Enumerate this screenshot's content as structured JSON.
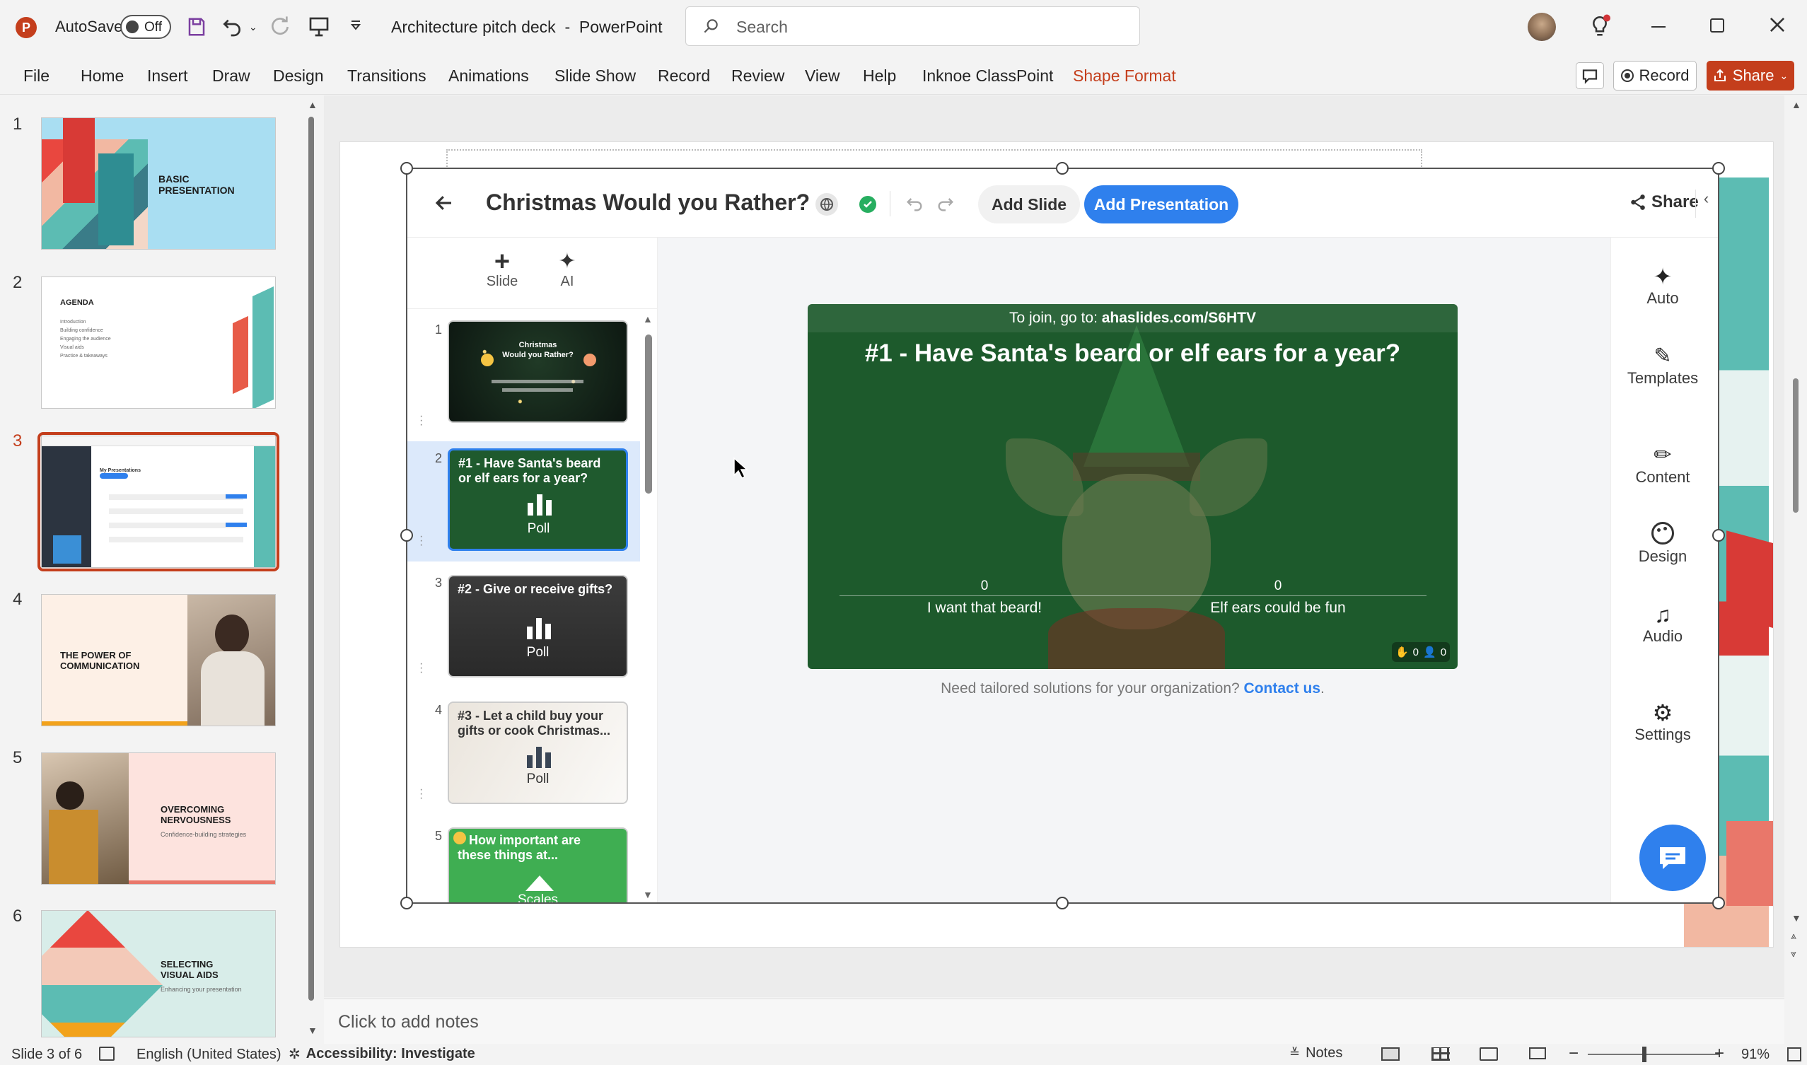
{
  "titlebar": {
    "autosave_label": "AutoSave",
    "autosave_state": "Off",
    "document_title": "Architecture pitch deck",
    "separator": "-",
    "app_name": "PowerPoint",
    "search_placeholder": "Search"
  },
  "ribbon": {
    "tabs": [
      "File",
      "Home",
      "Insert",
      "Draw",
      "Design",
      "Transitions",
      "Animations",
      "Slide Show",
      "Record",
      "Review",
      "View",
      "Help",
      "Inknoe ClassPoint",
      "Shape Format"
    ],
    "active_contextual_color": "#c43e1c",
    "record_label": "Record",
    "share_label": "Share"
  },
  "thumbnails": [
    {
      "num": "1",
      "title_lines": [
        "BASIC",
        "PRESENTATION"
      ]
    },
    {
      "num": "2",
      "title": "AGENDA",
      "bullets": [
        "Introduction",
        "Building confidence",
        "Engaging the audience",
        "Visual aids",
        "Practice & takeaways"
      ]
    },
    {
      "num": "3",
      "selected": true,
      "mini_title": "My Presentations"
    },
    {
      "num": "4",
      "title_lines": [
        "THE POWER OF",
        "COMMUNICATION"
      ]
    },
    {
      "num": "5",
      "title_lines": [
        "OVERCOMING",
        "NERVOUSNESS"
      ],
      "subtitle": "Confidence-building strategies"
    },
    {
      "num": "6",
      "title_lines": [
        "SELECTING",
        "VISUAL AIDS"
      ],
      "subtitle": "Enhancing your presentation"
    }
  ],
  "app": {
    "presentation_title": "Christmas Would you Rather?",
    "add_slide_label": "Add Slide",
    "add_presentation_label": "Add Presentation",
    "share_label": "Share",
    "toolbar": {
      "slide_label": "Slide",
      "ai_label": "AI"
    },
    "slides": [
      {
        "num": "1",
        "title_lines": [
          "Christmas",
          "Would you Rather?"
        ],
        "type": ""
      },
      {
        "num": "2",
        "title_lines": [
          "#1 - Have Santa's beard",
          "or elf ears for a year?"
        ],
        "type": "Poll",
        "selected": true
      },
      {
        "num": "3",
        "title_lines": [
          "#2 - Give or receive gifts?"
        ],
        "type": "Poll"
      },
      {
        "num": "4",
        "title_lines": [
          "#3 - Let a child buy your",
          "gifts or cook Christmas..."
        ],
        "type": "Poll"
      },
      {
        "num": "5",
        "title_lines": [
          "How important are",
          "these things at..."
        ],
        "type": "Scales"
      }
    ],
    "preview": {
      "join_prefix": "To join, go to: ",
      "join_url": "ahaslides.com/S6HTV",
      "question": "#1 - Have Santa's beard or elf ears for a year?",
      "options": [
        {
          "label": "I want that beard!",
          "count": "0"
        },
        {
          "label": "Elf ears could be fun",
          "count": "0"
        }
      ],
      "reactions_count": "0",
      "participants_count": "0"
    },
    "footer_text": "Need tailored solutions for your organization?",
    "footer_link": "Contact us",
    "footer_period": ".",
    "right_panel": [
      "Auto",
      "Templates",
      "Content",
      "Design",
      "Audio",
      "Settings"
    ],
    "accent_color": "#2f80ed",
    "slide_bg_color": "#1f5a2e"
  },
  "notes_placeholder": "Click to add notes",
  "status": {
    "slide_indicator": "Slide 3 of 6",
    "language": "English (United States)",
    "accessibility": "Accessibility: Investigate",
    "notes_label": "Notes",
    "zoom_percent": "91%"
  }
}
